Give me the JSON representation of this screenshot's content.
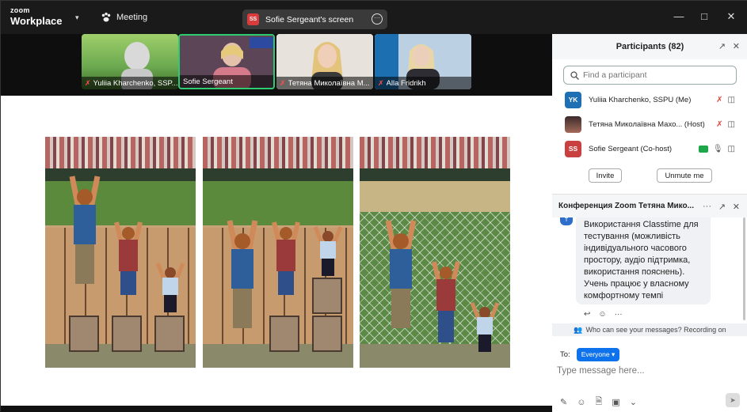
{
  "app": {
    "brand_top": "zoom",
    "brand_bottom": "Workplace",
    "meeting_label": "Meeting"
  },
  "share": {
    "badge": "SS",
    "label": "Sofie Sergeant's screen"
  },
  "video_tiles": [
    {
      "name": "Yuliia Kharchenko, SSP...",
      "muted": true
    },
    {
      "name": "Sofie Sergeant",
      "muted": false,
      "active": true
    },
    {
      "name": "Тетяна Миколаївна М...",
      "muted": true
    },
    {
      "name": "Alla Fridrikh",
      "muted": true
    }
  ],
  "participants_panel": {
    "title": "Participants (82)",
    "search_placeholder": "Find a participant",
    "participants": [
      {
        "initials": "YK",
        "name": "Yuliia Kharchenko, SSPU (Me)",
        "color": "#1f6fb5"
      },
      {
        "initials": "",
        "name": "Тетяна Миколаївна Махо... (Host)",
        "color": "#7b4a3a"
      },
      {
        "initials": "SS",
        "name": "Sofie Sergeant (Co-host)",
        "color": "#c94040"
      }
    ],
    "invite_label": "Invite",
    "unmute_label": "Unmute me"
  },
  "chat": {
    "title": "Конференция Zoom Тетяна Мико...",
    "message": "Використання Classtime для тестування (можливість індивідуального часового простору, аудіо підтримка, використання пояснень). Учень працює у власному комфортному темпі",
    "notice": "Who can see your messages? Recording on",
    "to_label": "To:",
    "recipient": "Everyone",
    "placeholder": "Type message here..."
  },
  "colors": {
    "accent": "#0e72ed",
    "mute_red": "#ff4d4d",
    "active_border": "#2ecc71"
  }
}
